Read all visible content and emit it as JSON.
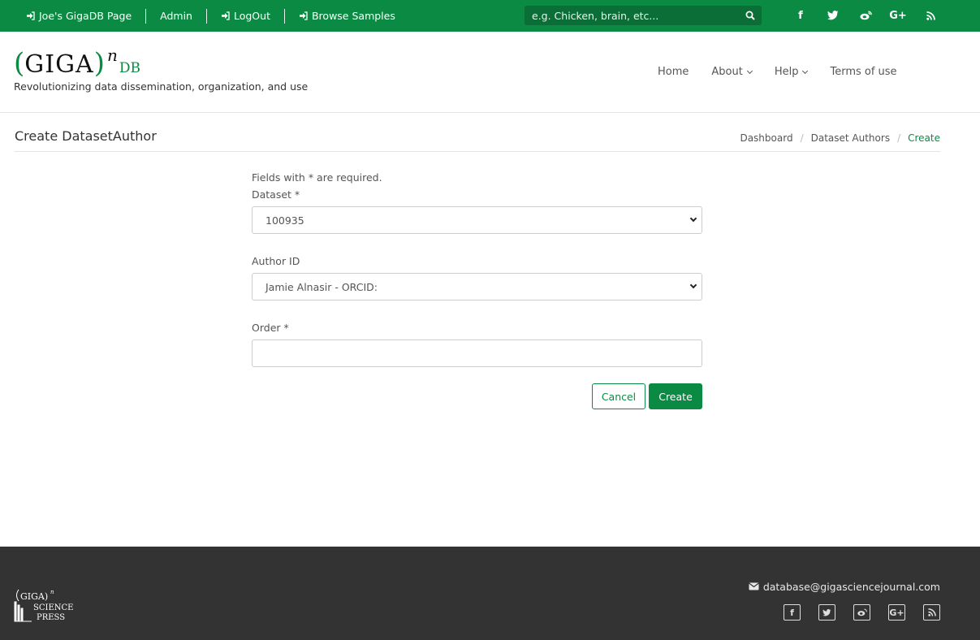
{
  "topnav": {
    "items": [
      {
        "label": "Joe's GigaDB Page",
        "icon": "sign-in-icon"
      },
      {
        "label": "Admin"
      },
      {
        "label": "LogOut",
        "icon": "sign-in-icon"
      },
      {
        "label": "Browse Samples",
        "icon": "sign-in-icon"
      }
    ],
    "search_placeholder": "e.g. Chicken, brain, etc...",
    "social": [
      "facebook-icon",
      "twitter-icon",
      "weibo-icon",
      "google-plus-icon",
      "rss-icon"
    ],
    "social_glyphs": {
      "facebook": "f",
      "gplus": "G+"
    }
  },
  "header": {
    "logo": {
      "paren_open": "(",
      "giga": "GIGA",
      "paren_close": ")",
      "n": "n",
      "db": "DB"
    },
    "tagline": "Revolutionizing data dissemination, organization, and use",
    "nav": [
      {
        "label": "Home"
      },
      {
        "label": "About",
        "dropdown": true
      },
      {
        "label": "Help",
        "dropdown": true
      },
      {
        "label": "Terms of use"
      }
    ]
  },
  "page": {
    "title": "Create DatasetAuthor",
    "breadcrumb": [
      "Dashboard",
      "Dataset Authors",
      "Create"
    ]
  },
  "form": {
    "required_note": "Fields with * are required.",
    "dataset": {
      "label": "Dataset *",
      "value": "100935"
    },
    "author": {
      "label": "Author ID",
      "value": "Jamie Alnasir - ORCID:"
    },
    "order": {
      "label": "Order *",
      "value": ""
    },
    "cancel_label": "Cancel",
    "create_label": "Create"
  },
  "footer": {
    "email": "database@gigasciencejournal.com",
    "social": [
      "facebook-icon",
      "twitter-icon",
      "weibo-icon",
      "google-plus-icon",
      "rss-icon"
    ],
    "social_glyphs": {
      "facebook": "f",
      "gplus": "G+"
    }
  },
  "colors": {
    "brand_green": "#0b8a43",
    "footer_bg": "#333333"
  }
}
